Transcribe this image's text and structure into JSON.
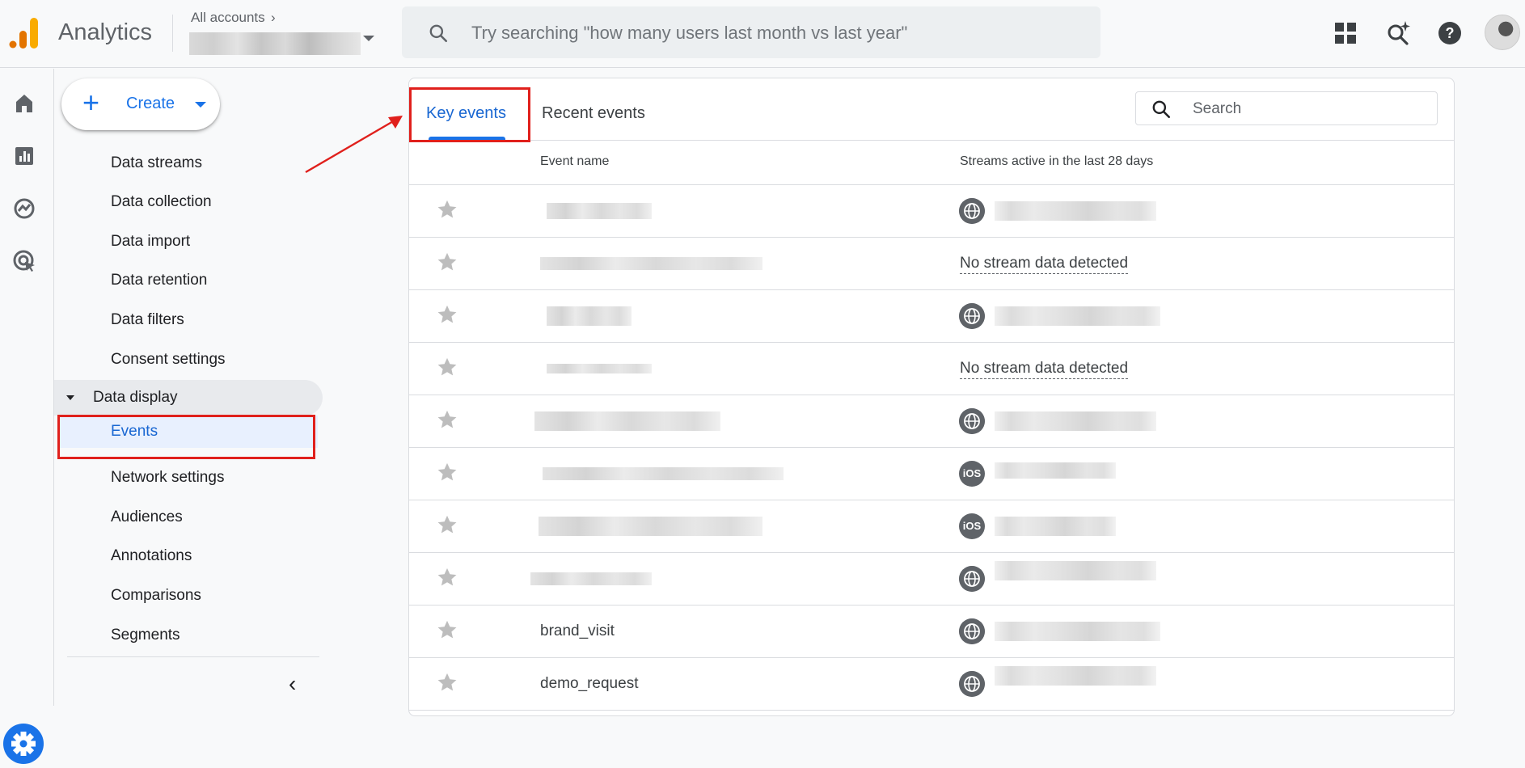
{
  "header": {
    "app_title": "Analytics",
    "account_label": "All accounts",
    "search_placeholder": "Try searching \"how many users last month vs last year\""
  },
  "nav": {
    "create_label": "Create",
    "items": [
      "Data streams",
      "Data collection",
      "Data import",
      "Data retention",
      "Data filters",
      "Consent settings"
    ],
    "section_label": "Data display",
    "active_item": "Events",
    "items_after": [
      "Network settings",
      "Audiences",
      "Annotations",
      "Comparisons",
      "Segments"
    ]
  },
  "tabs": {
    "key_events": "Key events",
    "recent_events": "Recent events"
  },
  "table": {
    "search_placeholder": "Search",
    "columns": [
      "Event name",
      "Streams active in the last 28 days"
    ],
    "rows": [
      {
        "event": "",
        "stream": "web"
      },
      {
        "event": "",
        "stream_text": "No stream data detected"
      },
      {
        "event": "",
        "stream": "web"
      },
      {
        "event": "",
        "stream_text": "No stream data detected"
      },
      {
        "event": "",
        "stream": "web"
      },
      {
        "event": "",
        "stream": "ios"
      },
      {
        "event": "",
        "stream": "ios"
      },
      {
        "event": "",
        "stream": "web"
      },
      {
        "event": "brand_visit",
        "stream": "web"
      },
      {
        "event": "demo_request",
        "stream": "web"
      }
    ],
    "ios_label": "iOS"
  },
  "colors": {
    "accent": "#1a73e8",
    "annotation": "#e0201c"
  }
}
